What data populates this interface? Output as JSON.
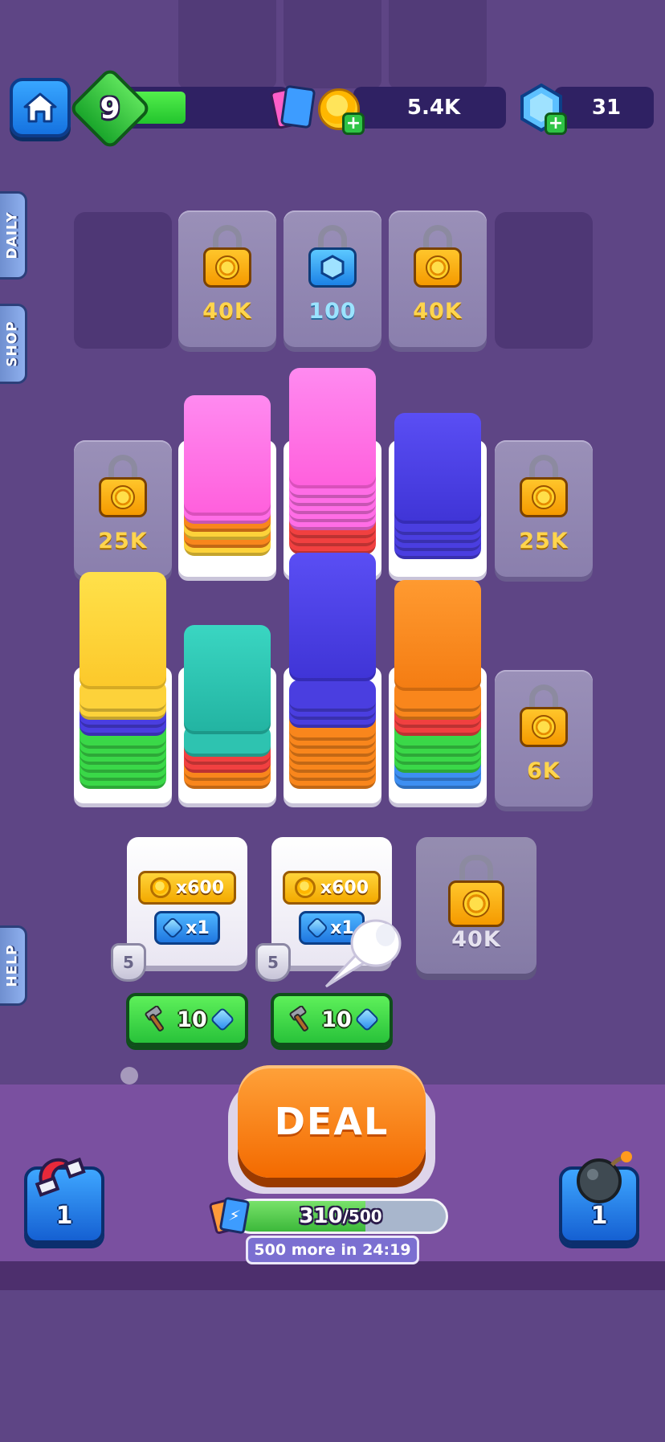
{
  "hud": {
    "level": "9",
    "level_progress": 0.35,
    "coins": "5.4K",
    "gems": "31"
  },
  "side_tabs": {
    "daily": "DAILY",
    "shop": "SHOP",
    "help": "HELP"
  },
  "board": {
    "top_row_prices": [
      "40K",
      "100",
      "40K"
    ],
    "left_lock_price": "25K",
    "right_lock_price": "25K",
    "right_lower_lock_price": "6K"
  },
  "colors": {
    "yellow": "#fdd23a",
    "orange": "#f9861c",
    "pink": "#ff6de6",
    "red": "#f14040",
    "blue": "#4a3ee0",
    "green": "#3ad848",
    "teal": "#2ec3b0",
    "lightblue": "#3d8ff2"
  },
  "rewards": [
    {
      "coin_label": "x600",
      "gem_label": "x1",
      "badge": "5",
      "price": "10"
    },
    {
      "coin_label": "x600",
      "gem_label": "x1",
      "badge": "5",
      "price": "10"
    }
  ],
  "reward_lock_price": "40K",
  "deal": {
    "label": "DEAL",
    "energy_current": "310",
    "energy_max": "/500",
    "energy_fraction": 0.62,
    "timer": "500 more in 24:19"
  },
  "boosters": {
    "magnet_count": "1",
    "bomb_count": "1"
  }
}
